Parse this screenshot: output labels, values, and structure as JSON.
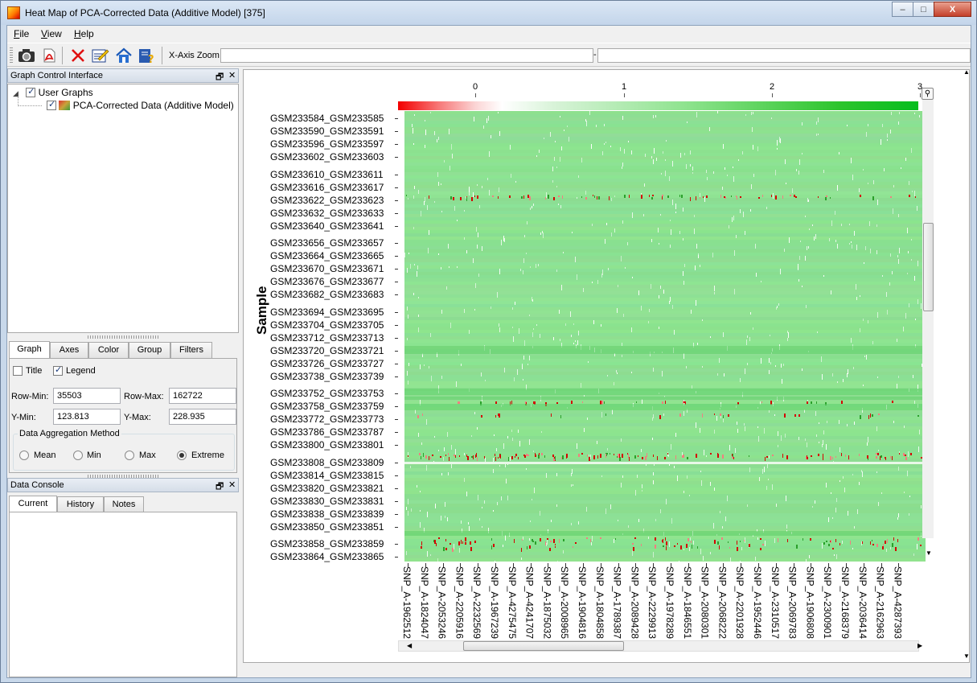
{
  "window": {
    "title": "Heat Map of PCA-Corrected Data (Additive Model) [375]",
    "minimize": "–",
    "maximize": "□",
    "close": "X"
  },
  "menu": [
    {
      "key": "F",
      "rest": "ile"
    },
    {
      "key": "V",
      "rest": "iew"
    },
    {
      "key": "H",
      "rest": "elp"
    }
  ],
  "toolbar": {
    "buttons": [
      "camera-icon",
      "pdf-icon",
      "delete-icon",
      "edit-icon",
      "home-icon",
      "help-icon"
    ],
    "zoom_label": "X-Axis Zoom",
    "zoom_dash": "-"
  },
  "graph_control": {
    "title": "Graph Control Interface",
    "tree": {
      "root": "User Graphs",
      "child": "PCA-Corrected Data (Additive Model)"
    },
    "tabs": [
      "Graph",
      "Axes",
      "Color",
      "Group",
      "Filters"
    ],
    "title_check": "Title",
    "legend_check": "Legend",
    "row_min_label": "Row-Min:",
    "row_min": "35503",
    "row_max_label": "Row-Max:",
    "row_max": "162722",
    "y_min_label": "Y-Min:",
    "y_min": "123.813",
    "y_max_label": "Y-Max:",
    "y_max": "228.935",
    "aggregation_title": "Data Aggregation Method",
    "aggregation": [
      "Mean",
      "Min",
      "Max",
      "Extreme"
    ],
    "aggregation_selected": "Extreme"
  },
  "data_console": {
    "title": "Data Console",
    "tabs": [
      "Current",
      "History",
      "Notes"
    ]
  },
  "heatmap": {
    "y_axis_title": "Sample",
    "colorbar_ticks": [
      "0",
      "1",
      "2",
      "3"
    ],
    "rows": [
      "GSM233584_GSM233585",
      "GSM233590_GSM233591",
      "GSM233596_GSM233597",
      "GSM233602_GSM233603",
      "GSM233610_GSM233611",
      "GSM233616_GSM233617",
      "GSM233622_GSM233623",
      "GSM233632_GSM233633",
      "GSM233640_GSM233641",
      "GSM233656_GSM233657",
      "GSM233664_GSM233665",
      "GSM233670_GSM233671",
      "GSM233676_GSM233677",
      "GSM233682_GSM233683",
      "GSM233694_GSM233695",
      "GSM233704_GSM233705",
      "GSM233712_GSM233713",
      "GSM233720_GSM233721",
      "GSM233726_GSM233727",
      "GSM233738_GSM233739",
      "GSM233752_GSM233753",
      "GSM233758_GSM233759",
      "GSM233772_GSM233773",
      "GSM233786_GSM233787",
      "GSM233800_GSM233801",
      "GSM233808_GSM233809",
      "GSM233814_GSM233815",
      "GSM233820_GSM233821",
      "GSM233830_GSM233831",
      "GSM233838_GSM233839",
      "GSM233850_GSM233851",
      "GSM233858_GSM233859",
      "GSM233864_GSM233865"
    ],
    "columns": [
      "SNP_A-1962512",
      "SNP_A-1824047",
      "SNP_A-2053246",
      "SNP_A-2205916",
      "SNP_A-2232569",
      "SNP_A-1967239",
      "SNP_A-4275475",
      "SNP_A-4241707",
      "SNP_A-1875032",
      "SNP_A-2008965",
      "SNP_A-1904816",
      "SNP_A-1804858",
      "SNP_A-1789387",
      "SNP_A-2089428",
      "SNP_A-2229913",
      "SNP_A-1978289",
      "SNP_A-1846551",
      "SNP_A-2080301",
      "SNP_A-2068222",
      "SNP_A-2201928",
      "SNP_A-1952446",
      "SNP_A-2310517",
      "SNP_A-2069783",
      "SNP_A-1906808",
      "SNP_A-2300901",
      "SNP_A-2168379",
      "SNP_A-2036414",
      "SNP_A-2162963",
      "SNP_A-4287393"
    ],
    "colors": {
      "low": "#f30000",
      "mid": "#ffffff",
      "high": "#06bd1e",
      "base": "#90e394"
    }
  }
}
